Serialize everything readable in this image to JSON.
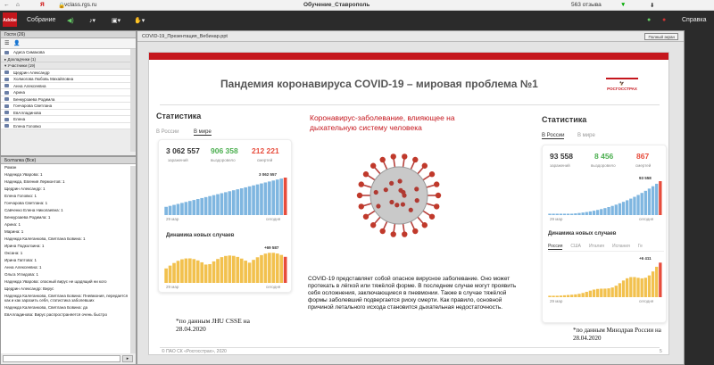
{
  "browser": {
    "url": "vclass.rgs.ru",
    "title": "Обучение_Ставрополь",
    "reviews": "563 отзыва"
  },
  "app": {
    "menu_meeting": "Собрание",
    "menu_help": "Справка",
    "logo": "Adobe"
  },
  "guests_panel": {
    "title": "Гости (26)",
    "first": "Адиса Симакова",
    "group_hosts": "▸ Докладчики (1)",
    "group_participants": "▾ Участники (19)",
    "participants": [
      "Щедрин Александр",
      "Холмогова Любовь Михайловна",
      "Анна Алексеевна",
      "Арина",
      "Бенкурзаева Родимла",
      "Гончарова Светлана",
      "ЕвАлладинова",
      "Елена",
      "Елена Головко"
    ]
  },
  "chat_panel": {
    "title": "Болталка (Все)",
    "lines": [
      "Роман",
      "Надежда Уварова: 1",
      "Надежда, Евгения Лермонтов: 1",
      "Щедрин Александр: 1",
      "Елена Головко: 1",
      "Гончарова Светлана: 1",
      "Савченко Елена Николаевна: 1",
      "Бенкурзаева Родимла: 1",
      "Арина: 1",
      "Марина: 1",
      "Надежда Калеганкова, Светлана Бовина: 1",
      "Ирина Подколзина: 1",
      "Оксана: 1",
      "Ирина Гаптова: 1",
      "Анна Алексеевна: 1",
      "Ольга Углидова: 1",
      "Надежда Уварова: опасный вирус не щадящий ни кого",
      "Щедрин Александр: Вирус",
      "Надежда Калеганкова, Светлана Бовина: Пневмония, передается как и как заразить себя, статистика заболевших",
      "Надежда Калеганкова, Светлана Бовина: да",
      "ЕвАлладинова: Вирус распространяется очень быстро"
    ]
  },
  "presentation": {
    "filename": "COVID-19_Презентация_Вебинар.ppt",
    "full_screen": "Полный экран",
    "page": "5"
  },
  "slide": {
    "title": "Пандемия коронавируса COVID-19 – мировая проблема №1",
    "logo": "РОСГОССТРАХ",
    "subtitle_line1": "Коронавирус-заболевание, влияющее на",
    "subtitle_line2": "дыхательную систему человека",
    "body": "COVID-19 представляет собой опасное вирусное заболевание. Оно может протекать в лёгкой или тяжёлой форме. В последнем случае могут проявить себя осложнения, заключающиеся в пневмонии. Также в случае тяжёлой формы заболевший подвергается риску смерти. Как правило, основной причиной летального исхода становится дыхательная недостаточность.",
    "footer": "© ПАО СК «Росгосстрах», 2020",
    "note_left": "*по данным JHU CSSE на 28.04.2020",
    "note_right": "*по данным Минздрав России на 28.04.2020",
    "left_stats": {
      "heading": "Статистика",
      "tab_russia": "В России",
      "tab_world": "В мире",
      "cases": "3 062 557",
      "cases_lbl": "заражений",
      "recovered": "906 358",
      "recovered_lbl": "выздоровело",
      "deaths": "212 221",
      "deaths_lbl": "смертей",
      "chart_top": "3 062 557",
      "date_start": "29 мар",
      "date_end": "сегодня",
      "dyn_heading": "Динамика новых случаев",
      "dyn_top": "+69 587"
    },
    "right_stats": {
      "heading": "Статистика",
      "tab_russia": "В России",
      "tab_world": "В мире",
      "cases": "93 558",
      "cases_lbl": "заражений",
      "recovered": "8 456",
      "recovered_lbl": "выздоровело",
      "deaths": "867",
      "deaths_lbl": "смертей",
      "chart_top": "93 558",
      "date_start": "29 мар",
      "date_end": "сегодня",
      "dyn_heading": "Динамика новых случаев",
      "tabs": [
        "Россия",
        "США",
        "Италия",
        "Испания",
        "Ге"
      ],
      "dyn_top": "+6 411"
    }
  },
  "colors": {
    "brand_red": "#c5161d",
    "bar_blue": "#7fb6e0",
    "bar_yellow": "#f2c14e",
    "accent_red": "#e74c3c",
    "recovered_green": "#4caf50"
  }
}
